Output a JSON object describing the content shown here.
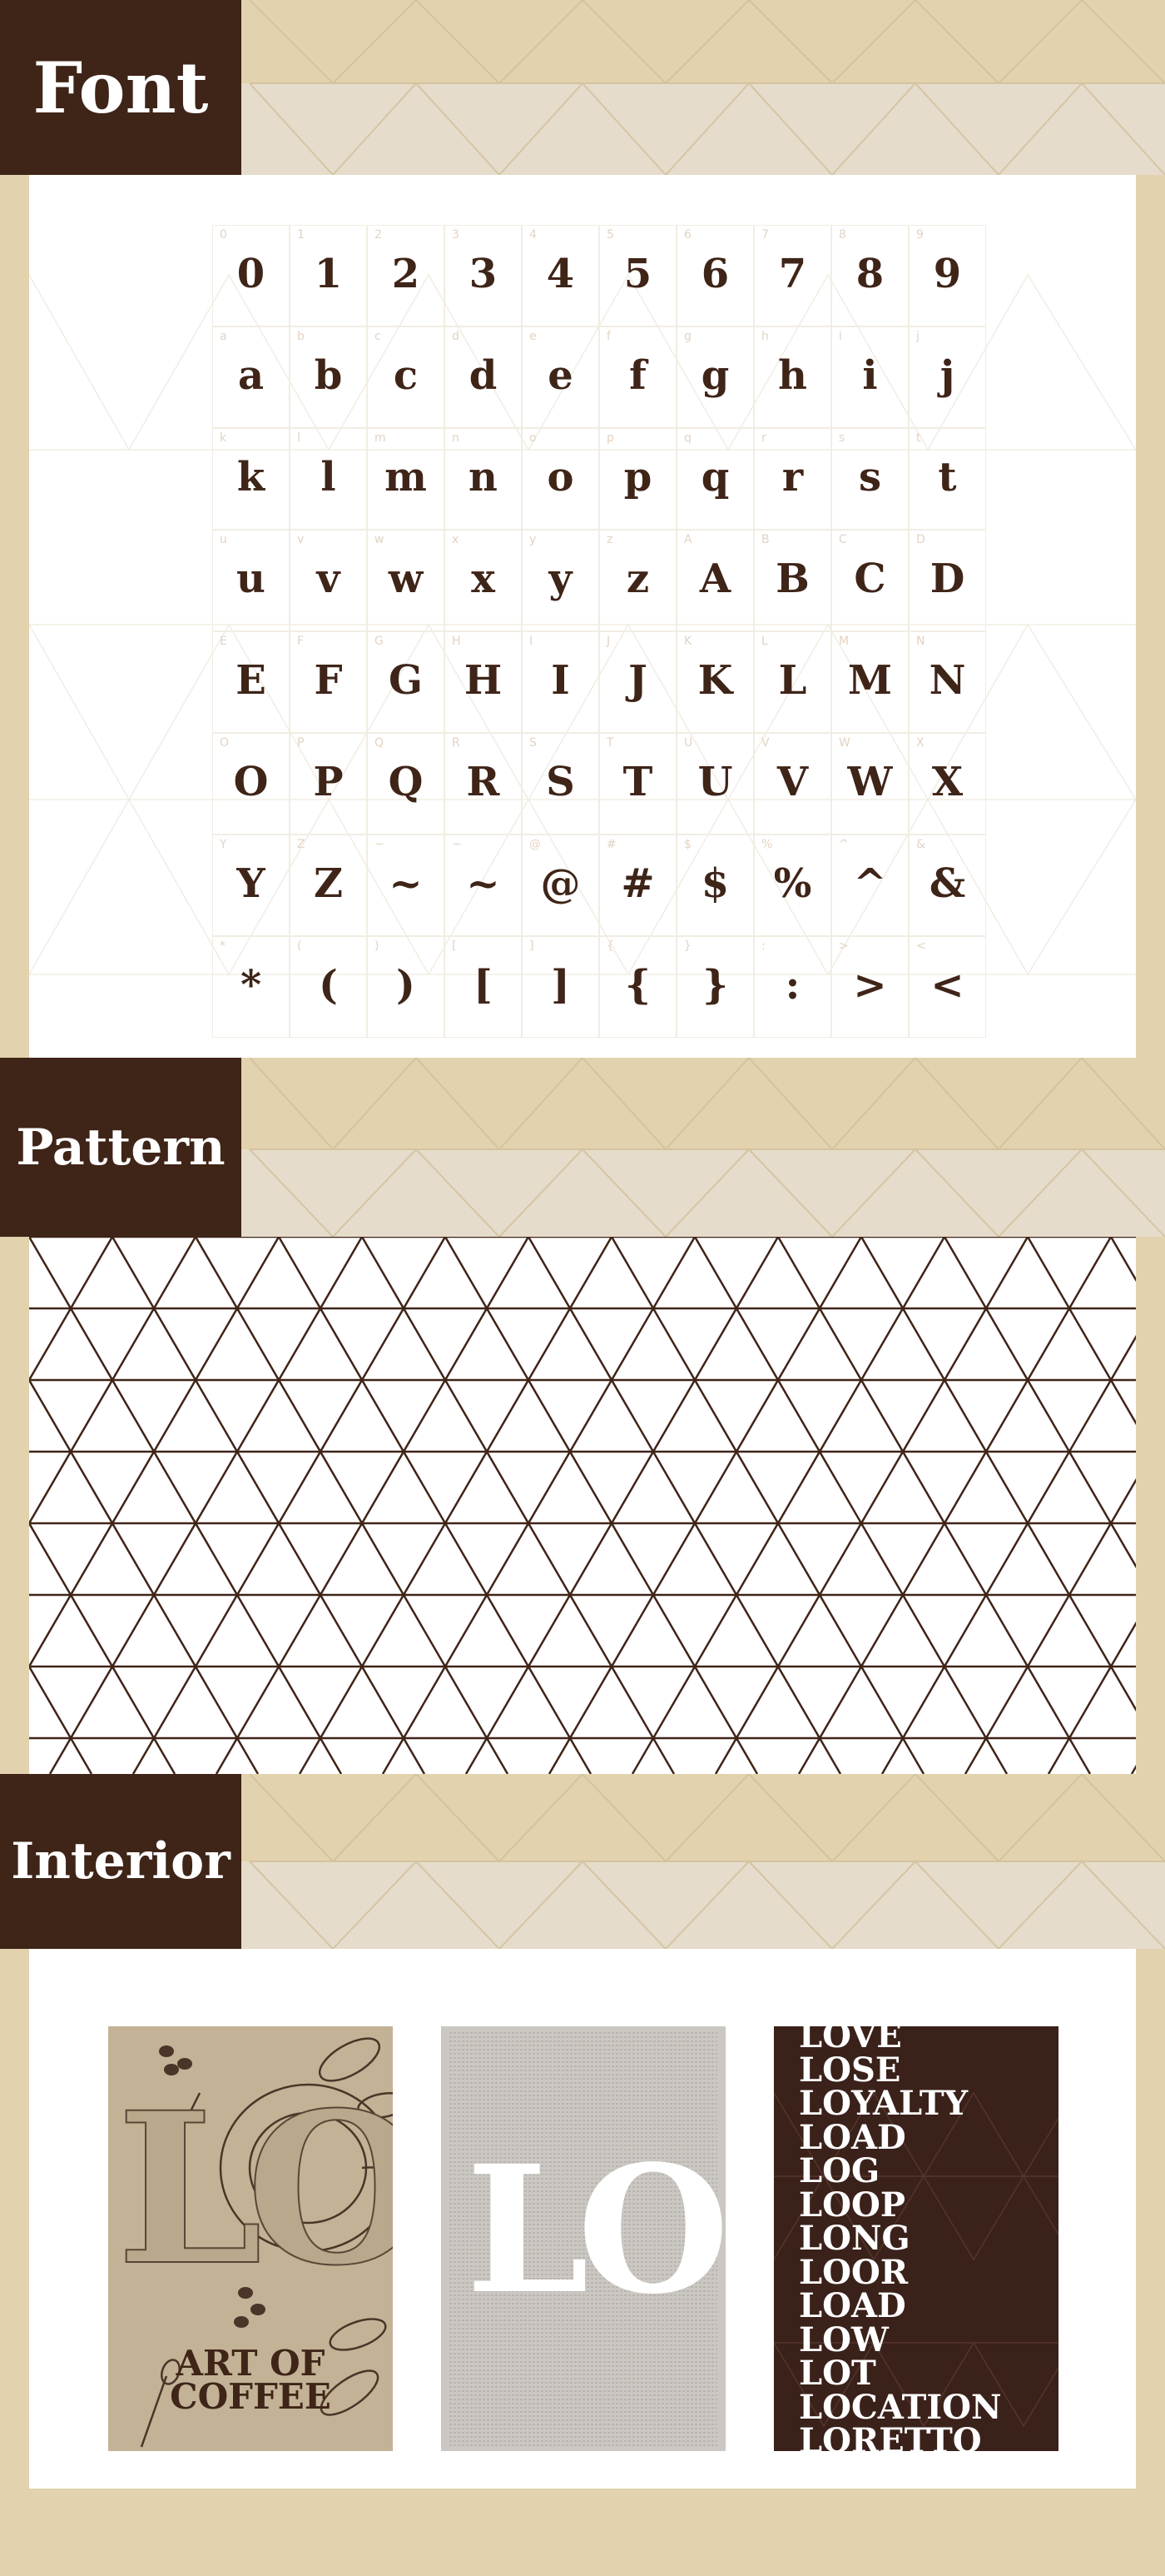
{
  "sections": {
    "font": {
      "title": "Font"
    },
    "pattern": {
      "title": "Pattern"
    },
    "interior": {
      "title": "Interior"
    }
  },
  "glyphs": [
    [
      "0",
      "1",
      "2",
      "3",
      "4",
      "5",
      "6",
      "7",
      "8",
      "9"
    ],
    [
      "a",
      "b",
      "c",
      "d",
      "e",
      "f",
      "g",
      "h",
      "i",
      "j"
    ],
    [
      "k",
      "l",
      "m",
      "n",
      "o",
      "p",
      "q",
      "r",
      "s",
      "t"
    ],
    [
      "u",
      "v",
      "w",
      "x",
      "y",
      "z",
      "A",
      "B",
      "C",
      "D"
    ],
    [
      "E",
      "F",
      "G",
      "H",
      "I",
      "J",
      "K",
      "L",
      "M",
      "N"
    ],
    [
      "O",
      "P",
      "Q",
      "R",
      "S",
      "T",
      "U",
      "V",
      "W",
      "X"
    ],
    [
      "Y",
      "Z",
      "~",
      "~",
      "@",
      "#",
      "$",
      "%",
      "^",
      "&"
    ],
    [
      "*",
      "(",
      ")",
      "[",
      "]",
      "{",
      "}",
      ":",
      ">",
      "<"
    ]
  ],
  "interior": {
    "poster1": {
      "monogram": "LO",
      "tagline_line1": "ART OF",
      "tagline_line2": "COFFEE"
    },
    "poster2": {
      "monogram": "LO"
    },
    "poster3": {
      "words": [
        "LOVE",
        "LOSE",
        "LOYALTY",
        "LOAD",
        "LOG",
        "LOOP",
        "LONG",
        "LOOR",
        "LOAD",
        "LOW",
        "LOT",
        "LOCATION",
        "LORETTO"
      ]
    }
  },
  "colors": {
    "brown": "#3f2418",
    "beige": "#e2d3ae",
    "white": "#ffffff"
  }
}
